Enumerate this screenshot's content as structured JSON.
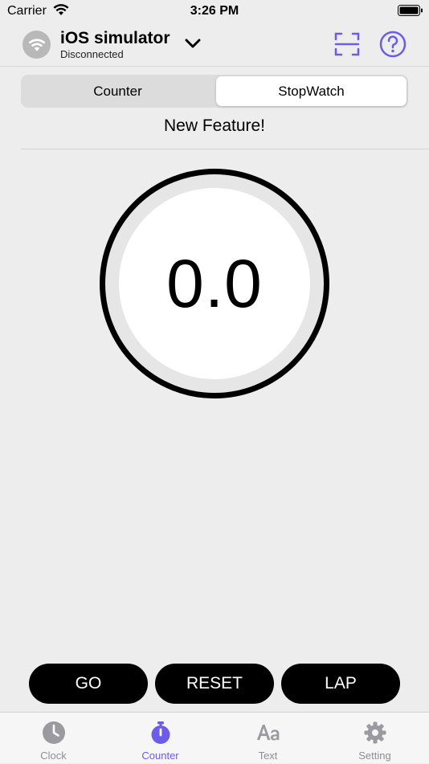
{
  "status_bar": {
    "carrier": "Carrier",
    "time": "3:26 PM"
  },
  "device": {
    "name": "iOS simulator",
    "state": "Disconnected"
  },
  "segments": {
    "counter": "Counter",
    "stopwatch": "StopWatch",
    "selected": "StopWatch"
  },
  "banner": "New Feature!",
  "stopwatch": {
    "time": "0.0"
  },
  "actions": {
    "go": "GO",
    "reset": "RESET",
    "lap": "LAP"
  },
  "tabs": [
    {
      "label": "Clock",
      "icon": "clock-icon",
      "active": false
    },
    {
      "label": "Counter",
      "icon": "stopwatch-icon",
      "active": true
    },
    {
      "label": "Text",
      "icon": "text-icon",
      "active": false
    },
    {
      "label": "Setting",
      "icon": "gear-icon",
      "active": false
    }
  ],
  "colors": {
    "accent": "#6d5ce7",
    "inactive": "#8e8e93",
    "background": "#ededed"
  }
}
